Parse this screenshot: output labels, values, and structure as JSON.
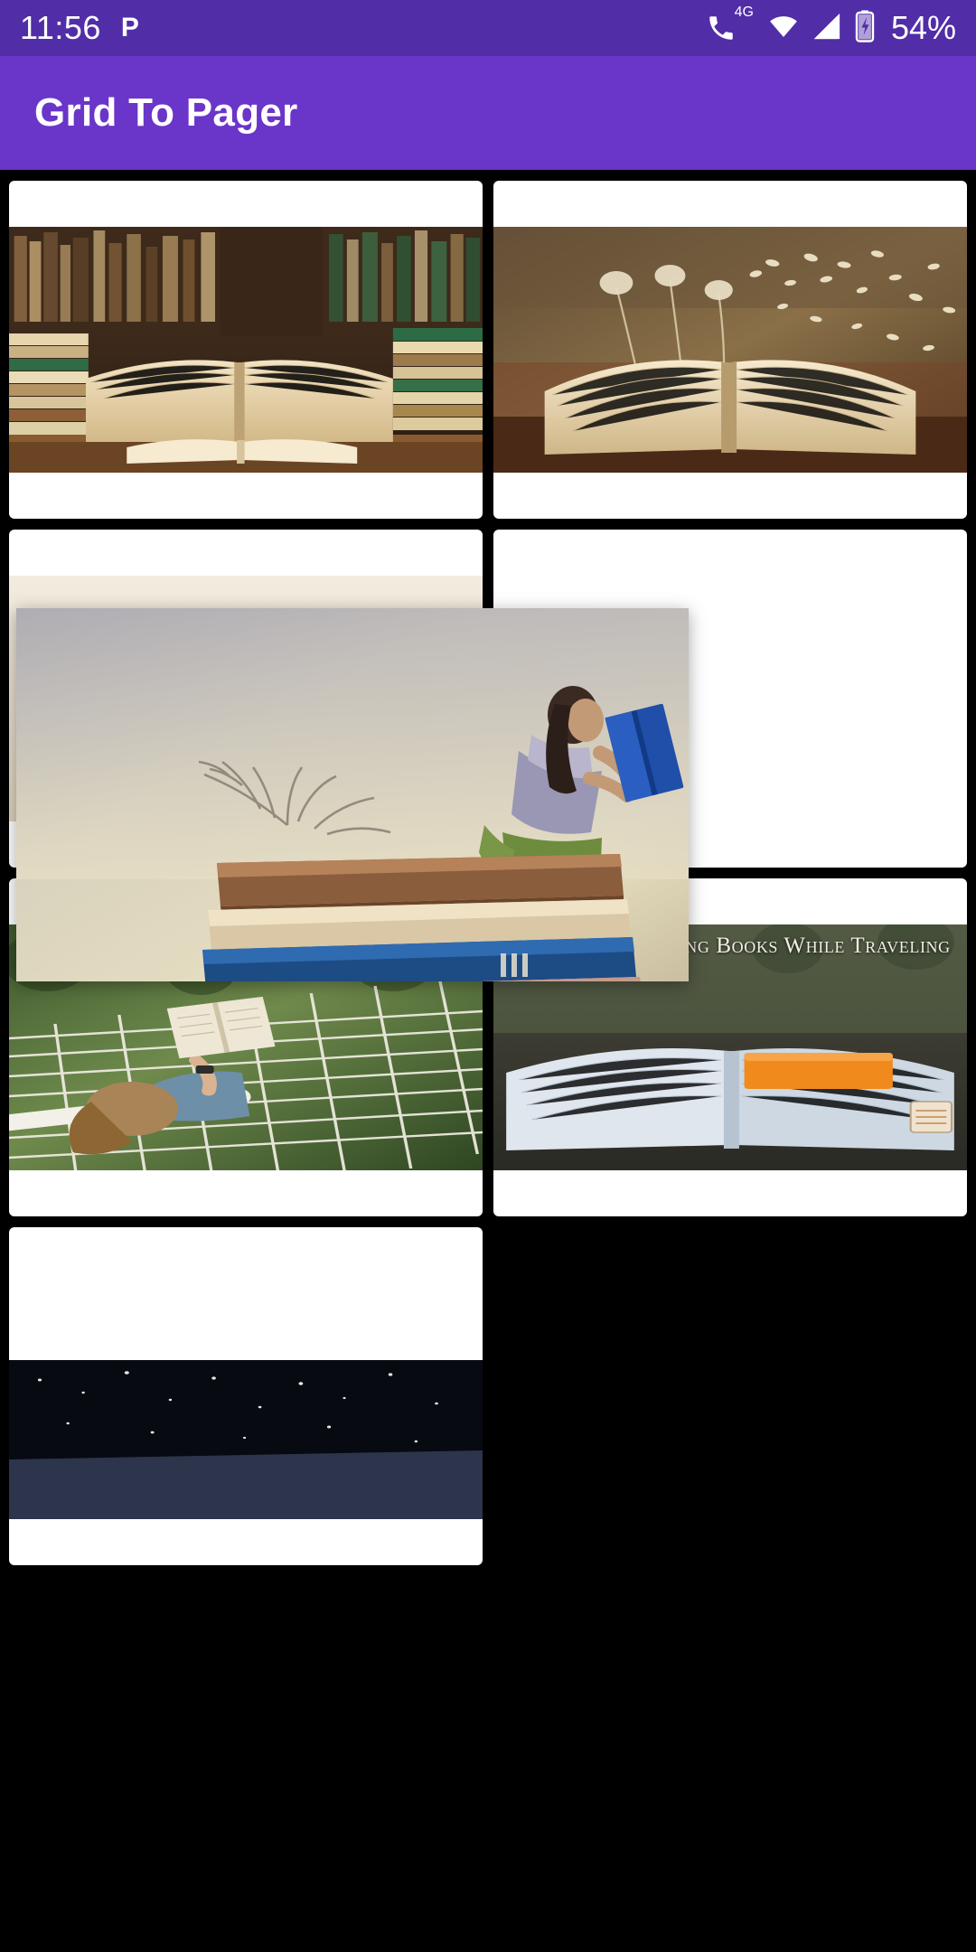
{
  "status_bar": {
    "time": "11:56",
    "app_icon": "P",
    "network_type": "4G",
    "battery_percent": "54%",
    "icons": [
      "phone-signal-icon",
      "wifi-icon",
      "cellular-signal-icon",
      "battery-charging-icon"
    ],
    "background_color": "#512da8"
  },
  "app_bar": {
    "title": "Grid To Pager",
    "background_color": "#6a35c9",
    "text_color": "#ffffff"
  },
  "grid": {
    "background_color": "#000000",
    "card_background": "#ffffff",
    "items": [
      {
        "id": 1,
        "name": "open-book-on-table-with-bookshelf",
        "alt": "Open book on wooden table in front of stacked books"
      },
      {
        "id": 2,
        "name": "open-book-with-butterflies",
        "alt": "Open book with butterflies flying out of it"
      },
      {
        "id": 3,
        "name": "stacked-books-pale",
        "alt": "Pale photo of stacked books"
      },
      {
        "id": 4,
        "name": "blank-card-top-right",
        "alt": "Card partially covered by dragged image"
      },
      {
        "id": 5,
        "name": "woman-reading-in-hammock",
        "alt": "Woman lying in a hammock reading a book"
      },
      {
        "id": 6,
        "name": "benefits-of-reading-books-while-traveling",
        "alt": "Open book with orange bookmark and caption",
        "caption": "Benefits of Reading Books While Traveling"
      },
      {
        "id": 7,
        "name": "dark-night-sky-book",
        "alt": "Dark image partially visible at bottom"
      }
    ]
  },
  "floating_image": {
    "name": "girl-reading-on-giant-books",
    "alt": "Girl sitting on a stack of giant books reading a blue book",
    "state": "dragged"
  }
}
